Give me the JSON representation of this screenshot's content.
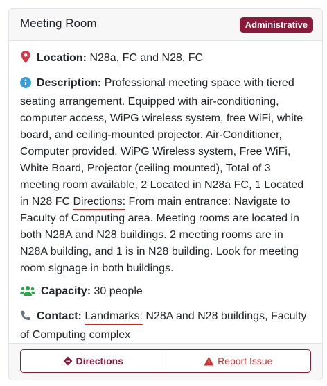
{
  "header": {
    "title": "Meeting Room",
    "badge": "Administrative"
  },
  "details": {
    "location_label": "Location:",
    "location_value": "N28a, FC and N28, FC",
    "description_label": "Description:",
    "description_text": "Professional meeting space with tiered seating arrangement. Equipped with air-conditioning, computer access, WiPG wireless system, free WiFi, white board, and ceiling-mounted projector. Air-Conditioner, Computer provided, WiPG Wireless system, Free WiFi, White Board, Projector (ceiling mounted), Total of 3 meeting room available, 2 Located in N28a FC, 1 Located in N28 FC",
    "directions_label": "Directions:",
    "directions_text": "From main entrance: Navigate to Faculty of Computing area. Meeting rooms are located in both N28A and N28 buildings. 2 meeting rooms are in N28A building, and 1 is in N28 building. Look for meeting room signage in both buildings.",
    "capacity_label": "Capacity:",
    "capacity_value": "30 people",
    "contact_label": "Contact:",
    "landmarks_label": "Landmarks:",
    "landmarks_text": "N28A and N28 buildings, Faculty of Computing complex"
  },
  "footer": {
    "directions_button": "Directions",
    "report_button": "Report Issue"
  },
  "icons": {
    "location": "map-pin-icon",
    "description": "info-circle-icon",
    "capacity": "users-icon",
    "contact": "phone-icon",
    "directions": "diamond-turn-icon",
    "report": "warning-triangle-icon"
  },
  "colors": {
    "accent": "#8b1a3a",
    "location_icon": "#dc3545",
    "info_icon": "#3a9fdd",
    "capacity_icon": "#28a745",
    "report": "#d62f2f",
    "annotation_underline": "#d4261e"
  }
}
